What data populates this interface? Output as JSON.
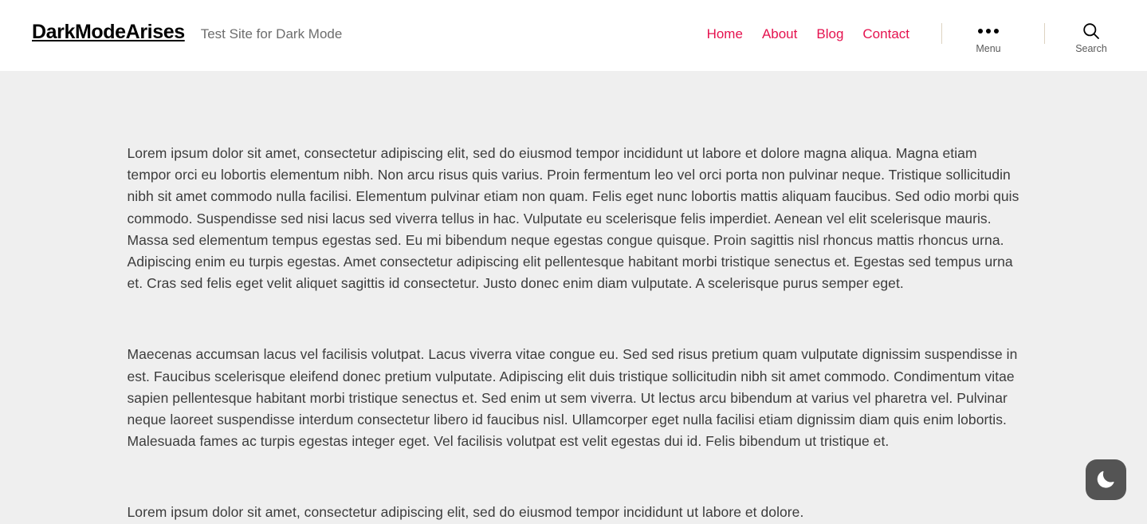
{
  "header": {
    "site_title": "DarkModeArises",
    "site_description": "Test Site for Dark Mode",
    "nav": [
      {
        "label": "Home"
      },
      {
        "label": "About"
      },
      {
        "label": "Blog"
      },
      {
        "label": "Contact"
      }
    ],
    "menu_button": {
      "label": "Menu",
      "icon": "three-dots-icon"
    },
    "search_button": {
      "label": "Search",
      "icon": "search-icon"
    }
  },
  "content": {
    "paragraphs": [
      "Lorem ipsum dolor sit amet, consectetur adipiscing elit, sed do eiusmod tempor incididunt ut labore et dolore magna aliqua. Magna etiam tempor orci eu lobortis elementum nibh. Non arcu risus quis varius. Proin fermentum leo vel orci porta non pulvinar neque. Tristique sollicitudin nibh sit amet commodo nulla facilisi. Elementum pulvinar etiam non quam. Felis eget nunc lobortis mattis aliquam faucibus. Sed odio morbi quis commodo. Suspendisse sed nisi lacus sed viverra tellus in hac. Vulputate eu scelerisque felis imperdiet. Aenean vel elit scelerisque mauris. Massa sed elementum tempus egestas sed. Eu mi bibendum neque egestas congue quisque. Proin sagittis nisl rhoncus mattis rhoncus urna. Adipiscing enim eu turpis egestas. Amet consectetur adipiscing elit pellentesque habitant morbi tristique senectus et. Egestas sed tempus urna et. Cras sed felis eget velit aliquet sagittis id consectetur. Justo donec enim diam vulputate. A scelerisque purus semper eget.",
      "Maecenas accumsan lacus vel facilisis volutpat. Lacus viverra vitae congue eu. Sed sed risus pretium quam vulputate dignissim suspendisse in est. Faucibus scelerisque eleifend donec pretium vulputate. Adipiscing elit duis tristique sollicitudin nibh sit amet commodo. Condimentum vitae sapien pellentesque habitant morbi tristique senectus et. Sed enim ut sem viverra. Ut lectus arcu bibendum at varius vel pharetra vel. Pulvinar neque laoreet suspendisse interdum consectetur libero id faucibus nisl. Ullamcorper eget nulla facilisi etiam dignissim diam quis enim lobortis. Malesuada fames ac turpis egestas integer eget. Vel facilisis volutpat est velit egestas dui id. Felis bibendum ut tristique et.",
      "Lorem ipsum dolor sit amet, consectetur adipiscing elit, sed do eiusmod tempor incididunt ut labore et dolore."
    ]
  },
  "dark_mode_toggle": {
    "icon": "moon-icon",
    "aria_label": "Dark Mode"
  },
  "colors": {
    "accent": "#e5124f",
    "header_background": "#ffffff",
    "page_background": "#efefef",
    "body_text": "#3c3c3c",
    "muted_text": "#6d6d6d",
    "divider": "#ddd3c1",
    "toggle_background": "#545454"
  }
}
